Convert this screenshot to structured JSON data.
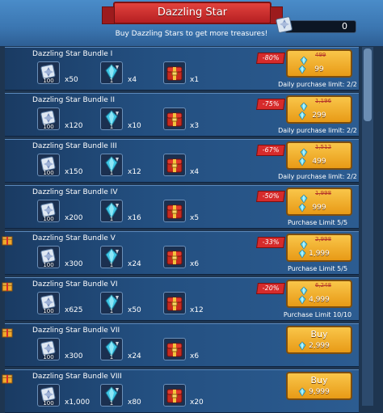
{
  "header": {
    "title": "Dazzling Star",
    "subtitle": "Buy Dazzling Stars to get more treasures!",
    "balance": "0"
  },
  "bundles": [
    {
      "name": "Dazzling Star Bundle I",
      "item1_qty": "100",
      "x1": "x50",
      "item2_qty": "1",
      "x2": "x4",
      "x3": "x1",
      "discount": "-80%",
      "old_price": "499",
      "price": "99",
      "limit": "Daily purchase limit: 2/2",
      "gift": false
    },
    {
      "name": "Dazzling Star Bundle II",
      "item1_qty": "100",
      "x1": "x120",
      "item2_qty": "1",
      "x2": "x10",
      "x3": "x3",
      "discount": "-75%",
      "old_price": "1,196",
      "price": "299",
      "limit": "Daily purchase limit: 2/2",
      "gift": false
    },
    {
      "name": "Dazzling Star Bundle III",
      "item1_qty": "100",
      "x1": "x150",
      "item2_qty": "1",
      "x2": "x12",
      "x3": "x4",
      "discount": "-67%",
      "old_price": "1,512",
      "price": "499",
      "limit": "Daily purchase limit: 2/2",
      "gift": false
    },
    {
      "name": "Dazzling Star Bundle IV",
      "item1_qty": "100",
      "x1": "x200",
      "item2_qty": "1",
      "x2": "x16",
      "x3": "x5",
      "discount": "-50%",
      "old_price": "1,998",
      "price": "999",
      "limit": "Purchase Limit 5/5",
      "gift": false
    },
    {
      "name": "Dazzling Star Bundle V",
      "item1_qty": "100",
      "x1": "x300",
      "item2_qty": "1",
      "x2": "x24",
      "x3": "x6",
      "discount": "-33%",
      "old_price": "2,998",
      "price": "1,999",
      "limit": "Purchase Limit 5/5",
      "gift": true
    },
    {
      "name": "Dazzling Star Bundle VI",
      "item1_qty": "100",
      "x1": "x625",
      "item2_qty": "1",
      "x2": "x50",
      "x3": "x12",
      "discount": "-20%",
      "old_price": "6,248",
      "price": "4,999",
      "limit": "Purchase Limit 10/10",
      "gift": true
    },
    {
      "name": "Dazzling Star Bundle VII",
      "item1_qty": "100",
      "x1": "x300",
      "item2_qty": "1",
      "x2": "x24",
      "x3": "x6",
      "buy_label": "Buy",
      "price": "2,999",
      "gift": true
    },
    {
      "name": "Dazzling Star Bundle VIII",
      "item1_qty": "100",
      "x1": "x1,000",
      "item2_qty": "1",
      "x2": "x80",
      "x3": "x20",
      "buy_label": "Buy",
      "price": "9,999",
      "gift": true
    }
  ],
  "colors": {
    "accent_gold": "#f2b234",
    "discount_red": "#d62b2b",
    "title_red": "#c9282a"
  }
}
